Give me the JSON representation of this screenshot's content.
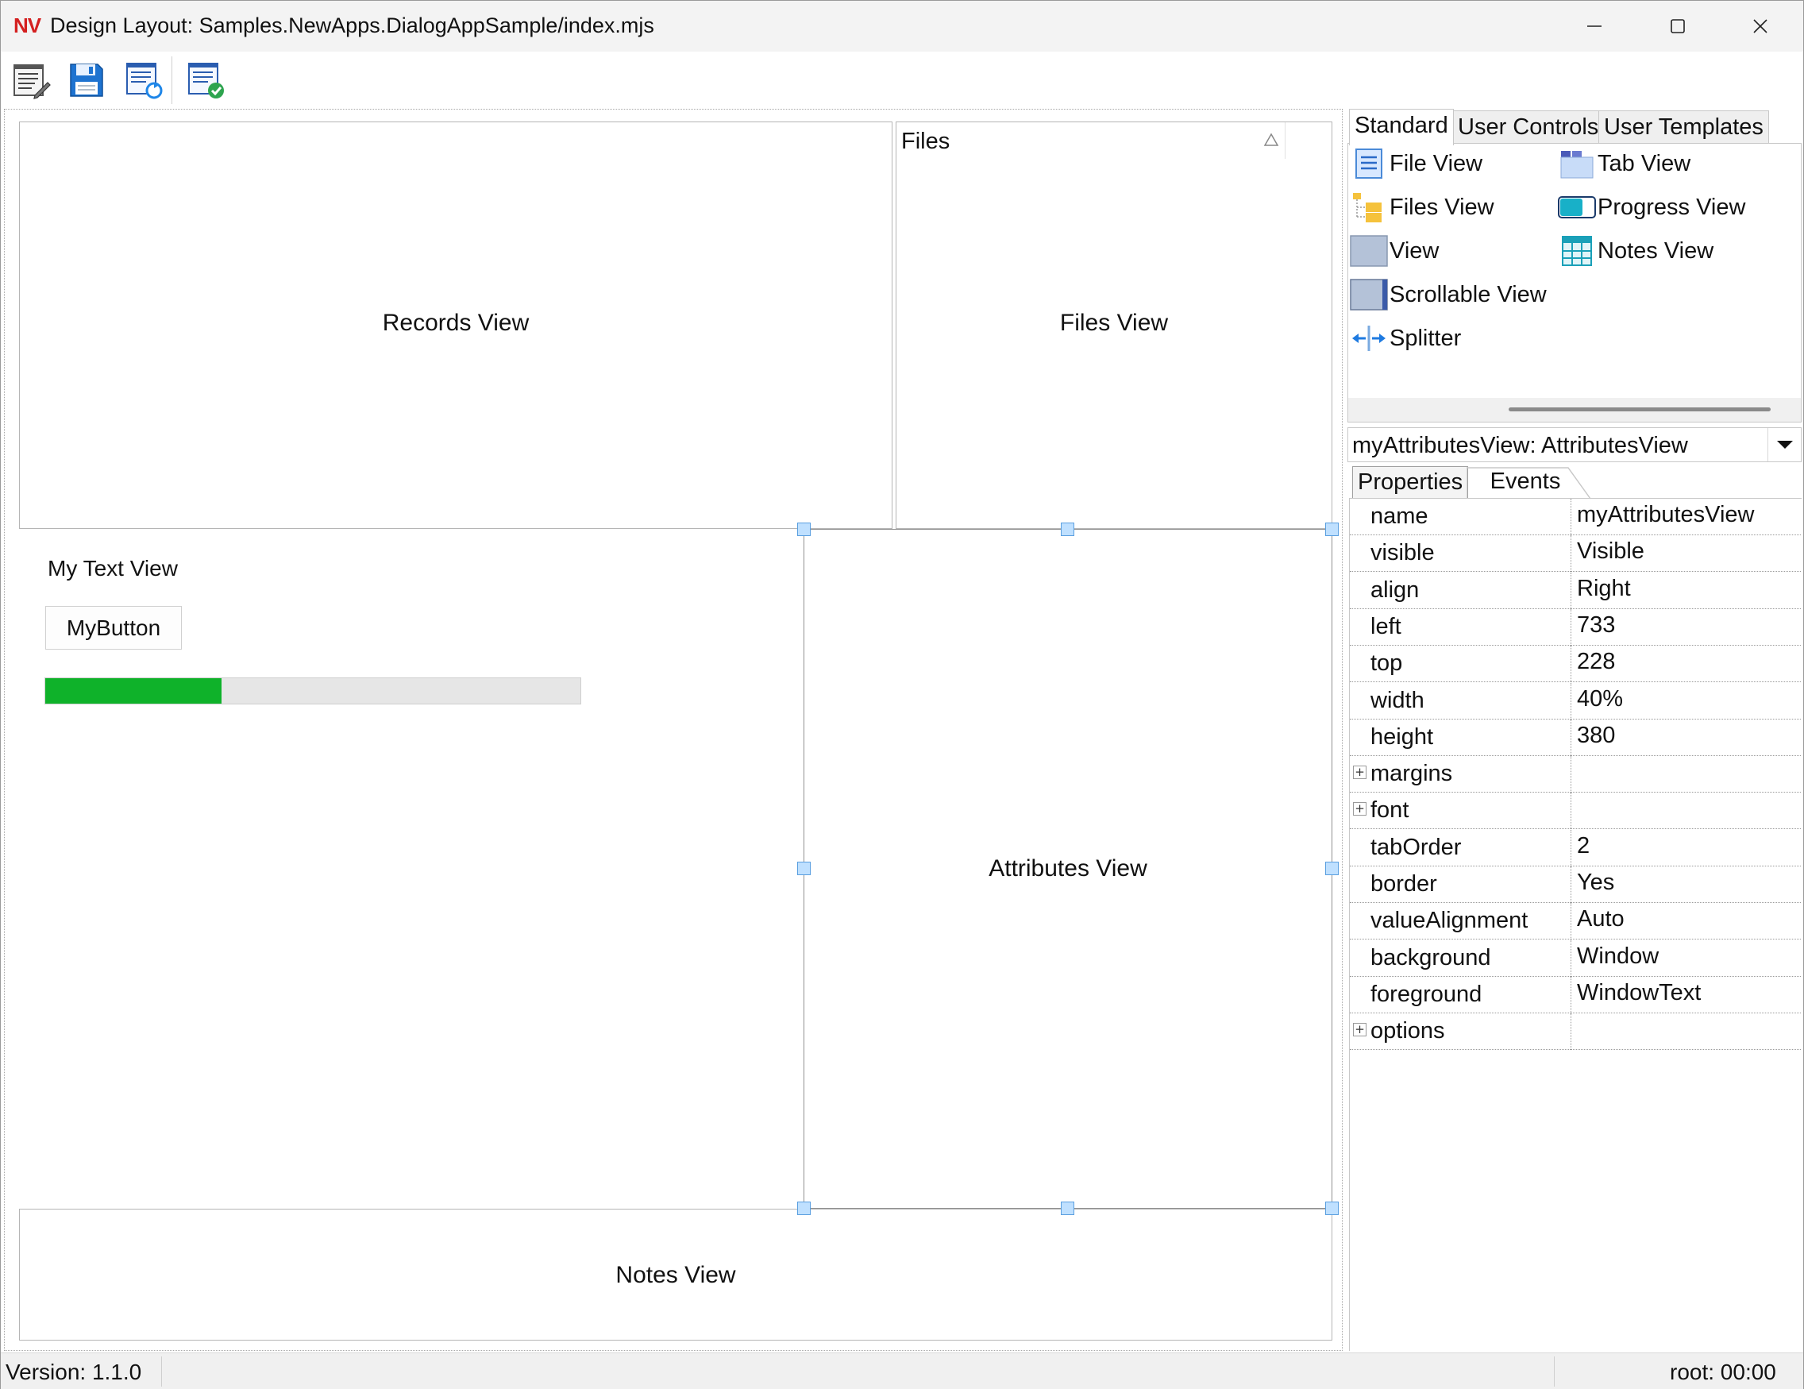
{
  "window": {
    "logo_text": "NV",
    "title": "Design Layout: Samples.NewApps.DialogAppSample/index.mjs"
  },
  "toolbar": {
    "icons": [
      "edit-list-icon",
      "save-icon",
      "refresh-list-icon",
      "validate-list-icon"
    ]
  },
  "canvas": {
    "records_view_label": "Records View",
    "files_header_label": "Files",
    "files_view_label": "Files View",
    "text_view_label": "My Text View",
    "button_label": "MyButton",
    "progress_fraction": 0.33,
    "attributes_view_label": "Attributes View",
    "notes_view_label": "Notes View"
  },
  "palette": {
    "tabs": [
      {
        "label": "Standard",
        "active": true
      },
      {
        "label": "User Controls",
        "active": false
      },
      {
        "label": "User Templates",
        "active": false
      }
    ],
    "items": [
      {
        "label": "File View",
        "icon": "file-view-icon"
      },
      {
        "label": "Tab View",
        "icon": "tab-view-icon"
      },
      {
        "label": "Files View",
        "icon": "files-view-icon"
      },
      {
        "label": "Progress View",
        "icon": "progress-view-icon"
      },
      {
        "label": "View",
        "icon": "view-icon"
      },
      {
        "label": "Notes View",
        "icon": "notes-view-icon"
      },
      {
        "label": "Scrollable View",
        "icon": "scrollable-view-icon"
      },
      {
        "label": "Splitter",
        "icon": "splitter-icon"
      }
    ]
  },
  "inspector": {
    "selected_object": "myAttributesView: AttributesView",
    "tabs": [
      "Properties",
      "Events"
    ],
    "properties": [
      {
        "name": "name",
        "value": "myAttributesView"
      },
      {
        "name": "visible",
        "value": "Visible"
      },
      {
        "name": "align",
        "value": "Right"
      },
      {
        "name": "left",
        "value": "733"
      },
      {
        "name": "top",
        "value": "228"
      },
      {
        "name": "width",
        "value": "40%"
      },
      {
        "name": "height",
        "value": "380"
      },
      {
        "name": "margins",
        "value": ""
      },
      {
        "name": "font",
        "value": ""
      },
      {
        "name": "tabOrder",
        "value": "2"
      },
      {
        "name": "border",
        "value": "Yes"
      },
      {
        "name": "valueAlignment",
        "value": "Auto"
      },
      {
        "name": "background",
        "value": "Window"
      },
      {
        "name": "foreground",
        "value": "WindowText"
      },
      {
        "name": "options",
        "value": ""
      }
    ]
  },
  "status": {
    "version": "Version: 1.1.0",
    "user_time": "root: 00:00"
  },
  "colors": {
    "progress_fill": "#0fb22a",
    "logo": "#d42020",
    "selection_handle": "#bfe0ff"
  }
}
